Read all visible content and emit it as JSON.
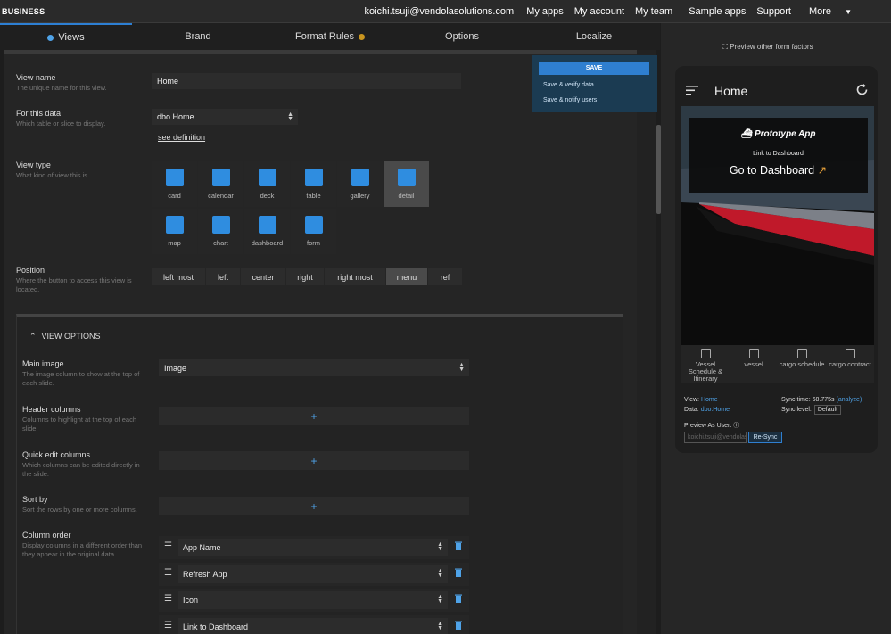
{
  "header": {
    "brand": "BUSINESS",
    "email": "koichi.tsuji@vendolasolutions.com",
    "my_apps": "My apps",
    "my_account": "My account",
    "my_team": "My team",
    "sample_apps": "Sample apps",
    "support": "Support",
    "more": "More"
  },
  "tabs": [
    "Views",
    "Brand",
    "Format Rules",
    "Options",
    "Localize"
  ],
  "form": {
    "view_name_label": "View name",
    "view_name_desc": "The unique name for this view.",
    "view_name_value": "Home",
    "for_data_label": "For this data",
    "for_data_desc": "Which table or slice to display.",
    "for_data_value": "dbo.Home",
    "see_definition": "see definition",
    "view_type_label": "View type",
    "view_type_desc": "What kind of view this is.",
    "view_types": [
      "card",
      "calendar",
      "deck",
      "table",
      "gallery",
      "detail",
      "map",
      "chart",
      "dashboard",
      "form"
    ],
    "position_label": "Position",
    "position_desc": "Where the button to access this view is located.",
    "positions": [
      "left most",
      "left",
      "center",
      "right",
      "right most",
      "menu",
      "ref"
    ]
  },
  "view_options": {
    "heading": "VIEW OPTIONS",
    "main_image_label": "Main image",
    "main_image_desc": "The image column to show at the top of each slide.",
    "main_image_value": "Image",
    "header_columns_label": "Header columns",
    "header_columns_desc": "Columns to highlight at the top of each slide.",
    "quick_edit_label": "Quick edit columns",
    "quick_edit_desc": "Which columns can be edited directly in the slide.",
    "sort_by_label": "Sort by",
    "sort_by_desc": "Sort the rows by one or more columns.",
    "column_order_label": "Column order",
    "column_order_desc": "Display columns in a different order than they appear in the original data.",
    "columns": [
      "App Name",
      "Refresh App",
      "Icon",
      "Link to Dashboard"
    ]
  },
  "save": {
    "save": "SAVE",
    "verify": "Save & verify data",
    "notify": "Save & notify users"
  },
  "preview": {
    "other_factors": "Preview other form factors",
    "title": "Home",
    "app_name": "Prototype App",
    "link_label": "Link to Dashboard",
    "go_dashboard": "Go to Dashboard",
    "nav": [
      "Vessel Schedule & Itinerary",
      "vessel",
      "cargo schedule",
      "cargo contract"
    ],
    "view_label": "View:",
    "view_value": "Home",
    "data_label": "Data:",
    "data_value": "dbo.Home",
    "sync_time": "Sync time: 68.775s",
    "analyze": "(analyze)",
    "sync_level_label": "Sync level:",
    "sync_level_value": "Default",
    "preview_as_user": "Preview As User:",
    "user_value": "koichi.tsuji@vendolasolutions.com",
    "resync": "Re-Sync"
  },
  "colors": {
    "accent": "#2f8de0",
    "tab_dot_orange": "#c9951f"
  }
}
